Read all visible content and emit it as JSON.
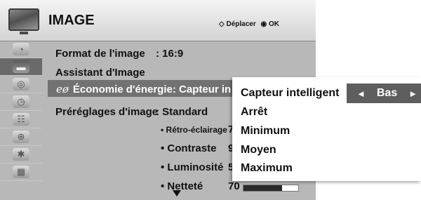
{
  "header": {
    "title": "IMAGE",
    "nav_hint": "Déplacer",
    "ok_hint": "OK",
    "move_icon_glyph": "◇",
    "ok_icon_glyph": "◉"
  },
  "sidebar": {
    "items": [
      {
        "icon": "satellite-dish-icon",
        "glyph": "◔"
      },
      {
        "icon": "picture-icon",
        "glyph": "▬",
        "active": true
      },
      {
        "icon": "speaker-icon",
        "glyph": "◎"
      },
      {
        "icon": "clock-icon",
        "glyph": "◷"
      },
      {
        "icon": "options-icon",
        "glyph": "☷"
      },
      {
        "icon": "lock-icon",
        "glyph": "⊕"
      },
      {
        "icon": "network-icon",
        "glyph": "✱"
      },
      {
        "icon": "film-icon",
        "glyph": "▦"
      }
    ]
  },
  "content": {
    "format_label": "Format de l'image",
    "format_value": ": 16:9",
    "assistant_label": "Assistant d'Image",
    "eco_glyph": "eø",
    "eco_label": "Économie d'énergie: Capteur in",
    "preset_label": "Préréglages d'image",
    "preset_value": ": Standard",
    "settings": [
      {
        "label": "• Rétro-éclairage",
        "value": "7"
      },
      {
        "label": "• Contraste",
        "value": "9"
      },
      {
        "label": "• Luminosité",
        "value": "5"
      },
      {
        "label": "• Netteté",
        "value": "70",
        "level": 0.7
      }
    ]
  },
  "popup": {
    "title": "Capteur intelligent",
    "selected": "Bas",
    "left_arrow": "◄",
    "right_arrow": "►",
    "options": [
      "Arrêt",
      "Minimum",
      "Moyen",
      "Maximum"
    ]
  }
}
